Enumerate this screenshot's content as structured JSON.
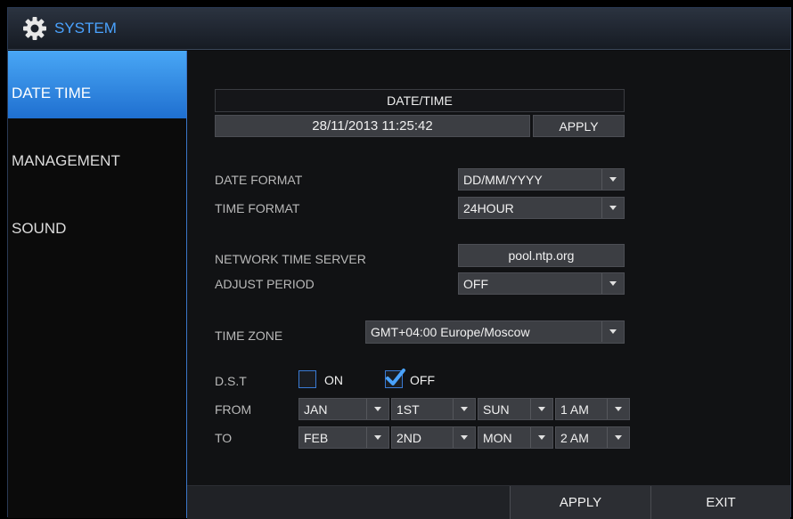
{
  "window": {
    "title": "SYSTEM",
    "icon": "gear-icon"
  },
  "sidebar": {
    "items": [
      {
        "label": "DATE TIME",
        "active": true
      },
      {
        "label": "MANAGEMENT",
        "active": false
      },
      {
        "label": "SOUND",
        "active": false
      }
    ]
  },
  "datetime": {
    "header": "DATE/TIME",
    "value": "28/11/2013 11:25:42",
    "apply_label": "APPLY"
  },
  "date_format": {
    "label": "DATE FORMAT",
    "value": "DD/MM/YYYY"
  },
  "time_format": {
    "label": "TIME FORMAT",
    "value": "24HOUR"
  },
  "ntp": {
    "label": "NETWORK TIME SERVER",
    "value": "pool.ntp.org"
  },
  "adjust_period": {
    "label": "ADJUST PERIOD",
    "value": "OFF"
  },
  "time_zone": {
    "label": "TIME ZONE",
    "value": "GMT+04:00 Europe/Moscow"
  },
  "dst": {
    "label": "D.S.T",
    "on_label": "ON",
    "on_checked": false,
    "off_label": "OFF",
    "off_checked": true,
    "from": {
      "label": "FROM",
      "month": "JAN",
      "week": "1ST",
      "day": "SUN",
      "hour": "1 AM"
    },
    "to": {
      "label": "TO",
      "month": "FEB",
      "week": "2ND",
      "day": "MON",
      "hour": "2 AM"
    }
  },
  "footer": {
    "apply_label": "APPLY",
    "exit_label": "EXIT"
  },
  "colors": {
    "accent": "#1f6fd0",
    "title_text": "#4aa3ff",
    "check": "#4aa3ff"
  }
}
